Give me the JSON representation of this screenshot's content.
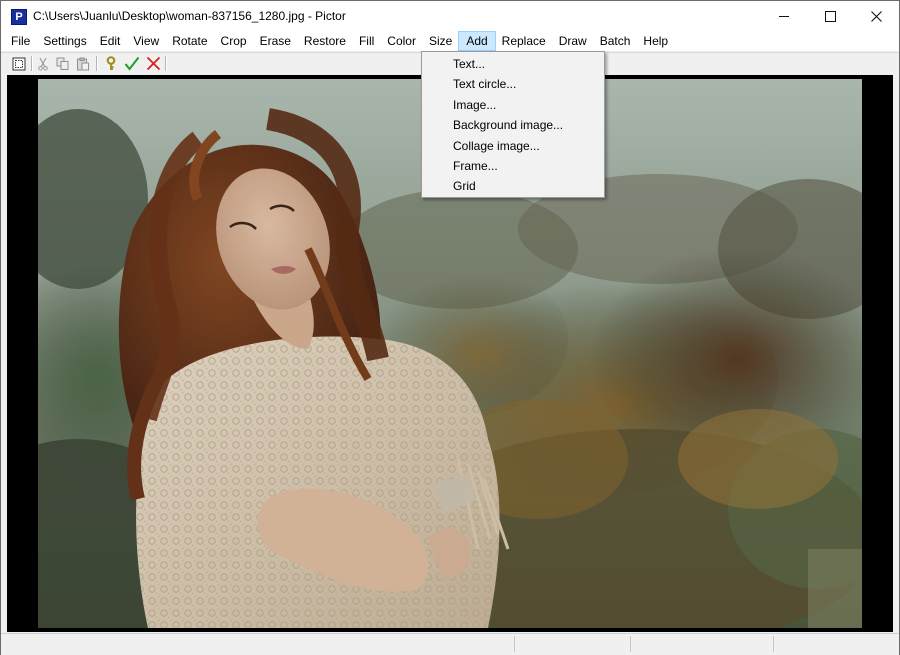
{
  "window": {
    "title": "C:\\Users\\Juanlu\\Desktop\\woman-837156_1280.jpg - Pictor",
    "app_icon_letter": "P"
  },
  "menubar": {
    "items": [
      "File",
      "Settings",
      "Edit",
      "View",
      "Rotate",
      "Crop",
      "Erase",
      "Restore",
      "Fill",
      "Color",
      "Size",
      "Add",
      "Replace",
      "Draw",
      "Batch",
      "Help"
    ],
    "active": "Add"
  },
  "add_menu": {
    "items": [
      "Text...",
      "Text circle...",
      "Image...",
      "Background image...",
      "Collage image...",
      "Frame...",
      "Grid"
    ]
  },
  "toolbar": {
    "icons": [
      "select-icon",
      "cut-icon",
      "copy-icon",
      "paste-icon",
      "key-icon",
      "check-icon",
      "cancel-icon"
    ],
    "colors": {
      "check": "#1e9e2a",
      "cancel": "#d91e1e",
      "key": "#a08a10"
    }
  },
  "image": {
    "subject": "woman in white crochet shawl, autumn foliage background"
  },
  "colors": {
    "menu_highlight": "#cce8ff",
    "canvas_bg": "#000000"
  }
}
